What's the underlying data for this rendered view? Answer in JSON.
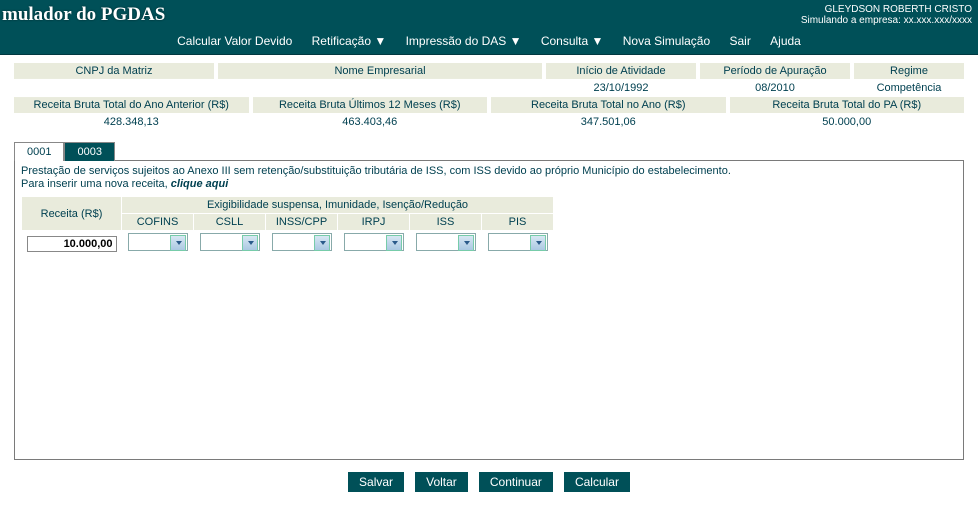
{
  "header": {
    "title": "mulador do PGDAS",
    "user": "GLEYDSON ROBERTH CRISTO",
    "simulating_label": "Simulando a empresa:",
    "simulating_value": "xx.xxx.xxx/xxxx"
  },
  "menu": {
    "calcular": "Calcular Valor Devido",
    "retificacao": "Retificação ▼",
    "impressao": "Impressão do DAS ▼",
    "consulta": "Consulta ▼",
    "nova_simulacao": "Nova Simulação",
    "sair": "Sair",
    "ajuda": "Ajuda"
  },
  "info": {
    "row1_labels": {
      "cnpj": "CNPJ da Matriz",
      "nome": "Nome Empresarial",
      "inicio": "Início de Atividade",
      "periodo": "Período de Apuração",
      "regime": "Regime"
    },
    "row1_values": {
      "cnpj": "",
      "nome": "",
      "inicio": "23/10/1992",
      "periodo": "08/2010",
      "regime": "Competência"
    },
    "row2_labels": {
      "rba": "Receita Bruta Total do Ano Anterior (R$)",
      "rb12": "Receita Bruta Últimos 12 Meses (R$)",
      "rbano": "Receita Bruta Total no Ano (R$)",
      "rbpa": "Receita Bruta Total do PA (R$)"
    },
    "row2_values": {
      "rba": "428.348,13",
      "rb12": "463.403,46",
      "rbano": "347.501,06",
      "rbpa": "50.000,00"
    }
  },
  "tabs": {
    "t1": "0001",
    "t2": "0003"
  },
  "panel": {
    "desc1": "Prestação de serviços sujeitos ao Anexo III sem retenção/substituição tributária de ISS, com ISS devido ao próprio Município do estabelecimento.",
    "desc2a": "Para inserir uma nova receita, ",
    "desc2b": "clique aqui",
    "table": {
      "receita_label": "Receita (R$)",
      "group_label": "Exigibilidade suspensa, Imunidade, Isenção/Redução",
      "cols": {
        "cofins": "COFINS",
        "csll": "CSLL",
        "inss": "INSS/CPP",
        "irpj": "IRPJ",
        "iss": "ISS",
        "pis": "PIS"
      },
      "receita_value": "10.000,00"
    }
  },
  "buttons": {
    "salvar": "Salvar",
    "voltar": "Voltar",
    "continuar": "Continuar",
    "calcular": "Calcular"
  }
}
